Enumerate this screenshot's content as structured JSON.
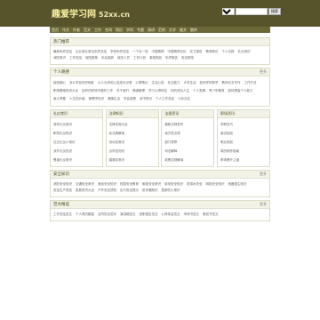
{
  "header": {
    "logo_main": "趣爱学习网",
    "logo_sub": "52xx.cn",
    "search_select": "全站",
    "search_button": "搜索"
  },
  "nav": [
    "首页",
    "作文",
    "作者",
    "范文",
    "工作",
    "合同",
    "简历",
    "学科",
    "专题",
    "演讲",
    "范例",
    "文学",
    "美文",
    "题库"
  ],
  "sections": {
    "hot": {
      "title": "热门推荐",
      "items": [
        "最新年终总结",
        "企业事业单位年终总结",
        "学校年终总结",
        "一个月一场",
        "中国精神",
        "中国精神文化",
        "实习报告",
        "教育新论",
        "个人月报",
        "礼仪常识",
        "消防常识",
        "工作总结",
        "保险推荐",
        "年会致辞",
        "保安人员",
        "工作计划",
        "事故物品",
        "年终报告",
        "安全规范"
      ]
    },
    "personal": {
      "title": "个人随感",
      "more": "更多",
      "items": [
        "经验随心",
        "怎么学会好好相处",
        "以人为本的心态成长记录",
        "心理笔记",
        "生活心态",
        "社交能力",
        "大学生活",
        "如何学好数学",
        "教师论文写作",
        "工作方法",
        "职场基础知识大全",
        "如何在职场中做好工作",
        "关于我们",
        "情绪管理",
        "学习心得体会",
        "你的成功人生",
        "个人发展",
        "青少年教育",
        "如何提高个人能力",
        "奋斗青春",
        "人生的价值",
        "管理学知识",
        "健康生活",
        "学会感恩",
        "读书笔记",
        "个人工作总结",
        "人际交往"
      ]
    },
    "columns": [
      {
        "title": "礼仪常识",
        "items": [
          "商务礼仪常识",
          "职场礼仪知识",
          "社交礼仪小常识",
          "涉外礼仪知识",
          "餐桌礼仪常识"
        ]
      },
      {
        "title": "法律知识",
        "items": [
          "法律法规大全",
          "民法典解读",
          "劳动法常识",
          "合同法知识",
          "婚姻法常识"
        ]
      },
      {
        "title": "法规资讯",
        "items": [
          "最新法规发布",
          "地方性法规",
          "部门规章",
          "司法解释",
          "政策法规解读"
        ]
      },
      {
        "title": "职场资讯",
        "items": [
          "求职技巧",
          "面试经验",
          "职业规划",
          "简历制作指南",
          "职场晋升之道"
        ]
      }
    ],
    "safety": {
      "title": "安全知识",
      "more": "更多",
      "items": [
        "消防安全知识",
        "交通安全常识",
        "食品安全知识",
        "校园安全教育",
        "家庭安全常识",
        "用电安全知识",
        "防溺水安全",
        "网络安全知识",
        "地震逃生知识",
        "安全生产规范",
        "急救常识大全",
        "户外安全须知",
        "出行安全提示",
        "防诈骗知识",
        "居家防火常识"
      ]
    },
    "sample": {
      "title": "范文精选",
      "more": "更多",
      "items": [
        "工作总结范文",
        "个人简历模板",
        "合同协议范本",
        "演讲稿范文",
        "述职报告范文",
        "心得体会范文",
        "申请书范文",
        "策划书范文"
      ]
    }
  }
}
